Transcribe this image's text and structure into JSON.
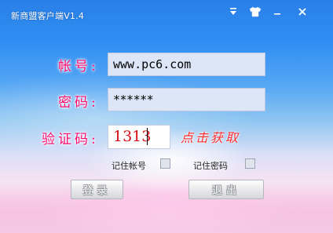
{
  "window": {
    "title": "新商盟客户端V1.4",
    "controls": {
      "menu_icon": "menu-down-icon",
      "skin_icon": "shirt-icon",
      "minimize_icon": "minimize-icon",
      "close_icon": "close-icon"
    }
  },
  "form": {
    "account": {
      "label": "帐号:",
      "value": "www.pc6.com"
    },
    "password": {
      "label": "密码:",
      "value": "******"
    },
    "captcha": {
      "label": "验证码:",
      "value": "1313",
      "get_link": "点击获取"
    },
    "options": {
      "remember_account": {
        "label": "记住帐号",
        "checked": false
      },
      "remember_password": {
        "label": "记住密码",
        "checked": false
      }
    },
    "buttons": {
      "login": "登录",
      "exit": "退出"
    }
  },
  "colors": {
    "label": "#ff0b6d",
    "captcha_value": "#d50f17",
    "get_link": "#ff2d2d",
    "field_bg": "#dce6f7"
  }
}
